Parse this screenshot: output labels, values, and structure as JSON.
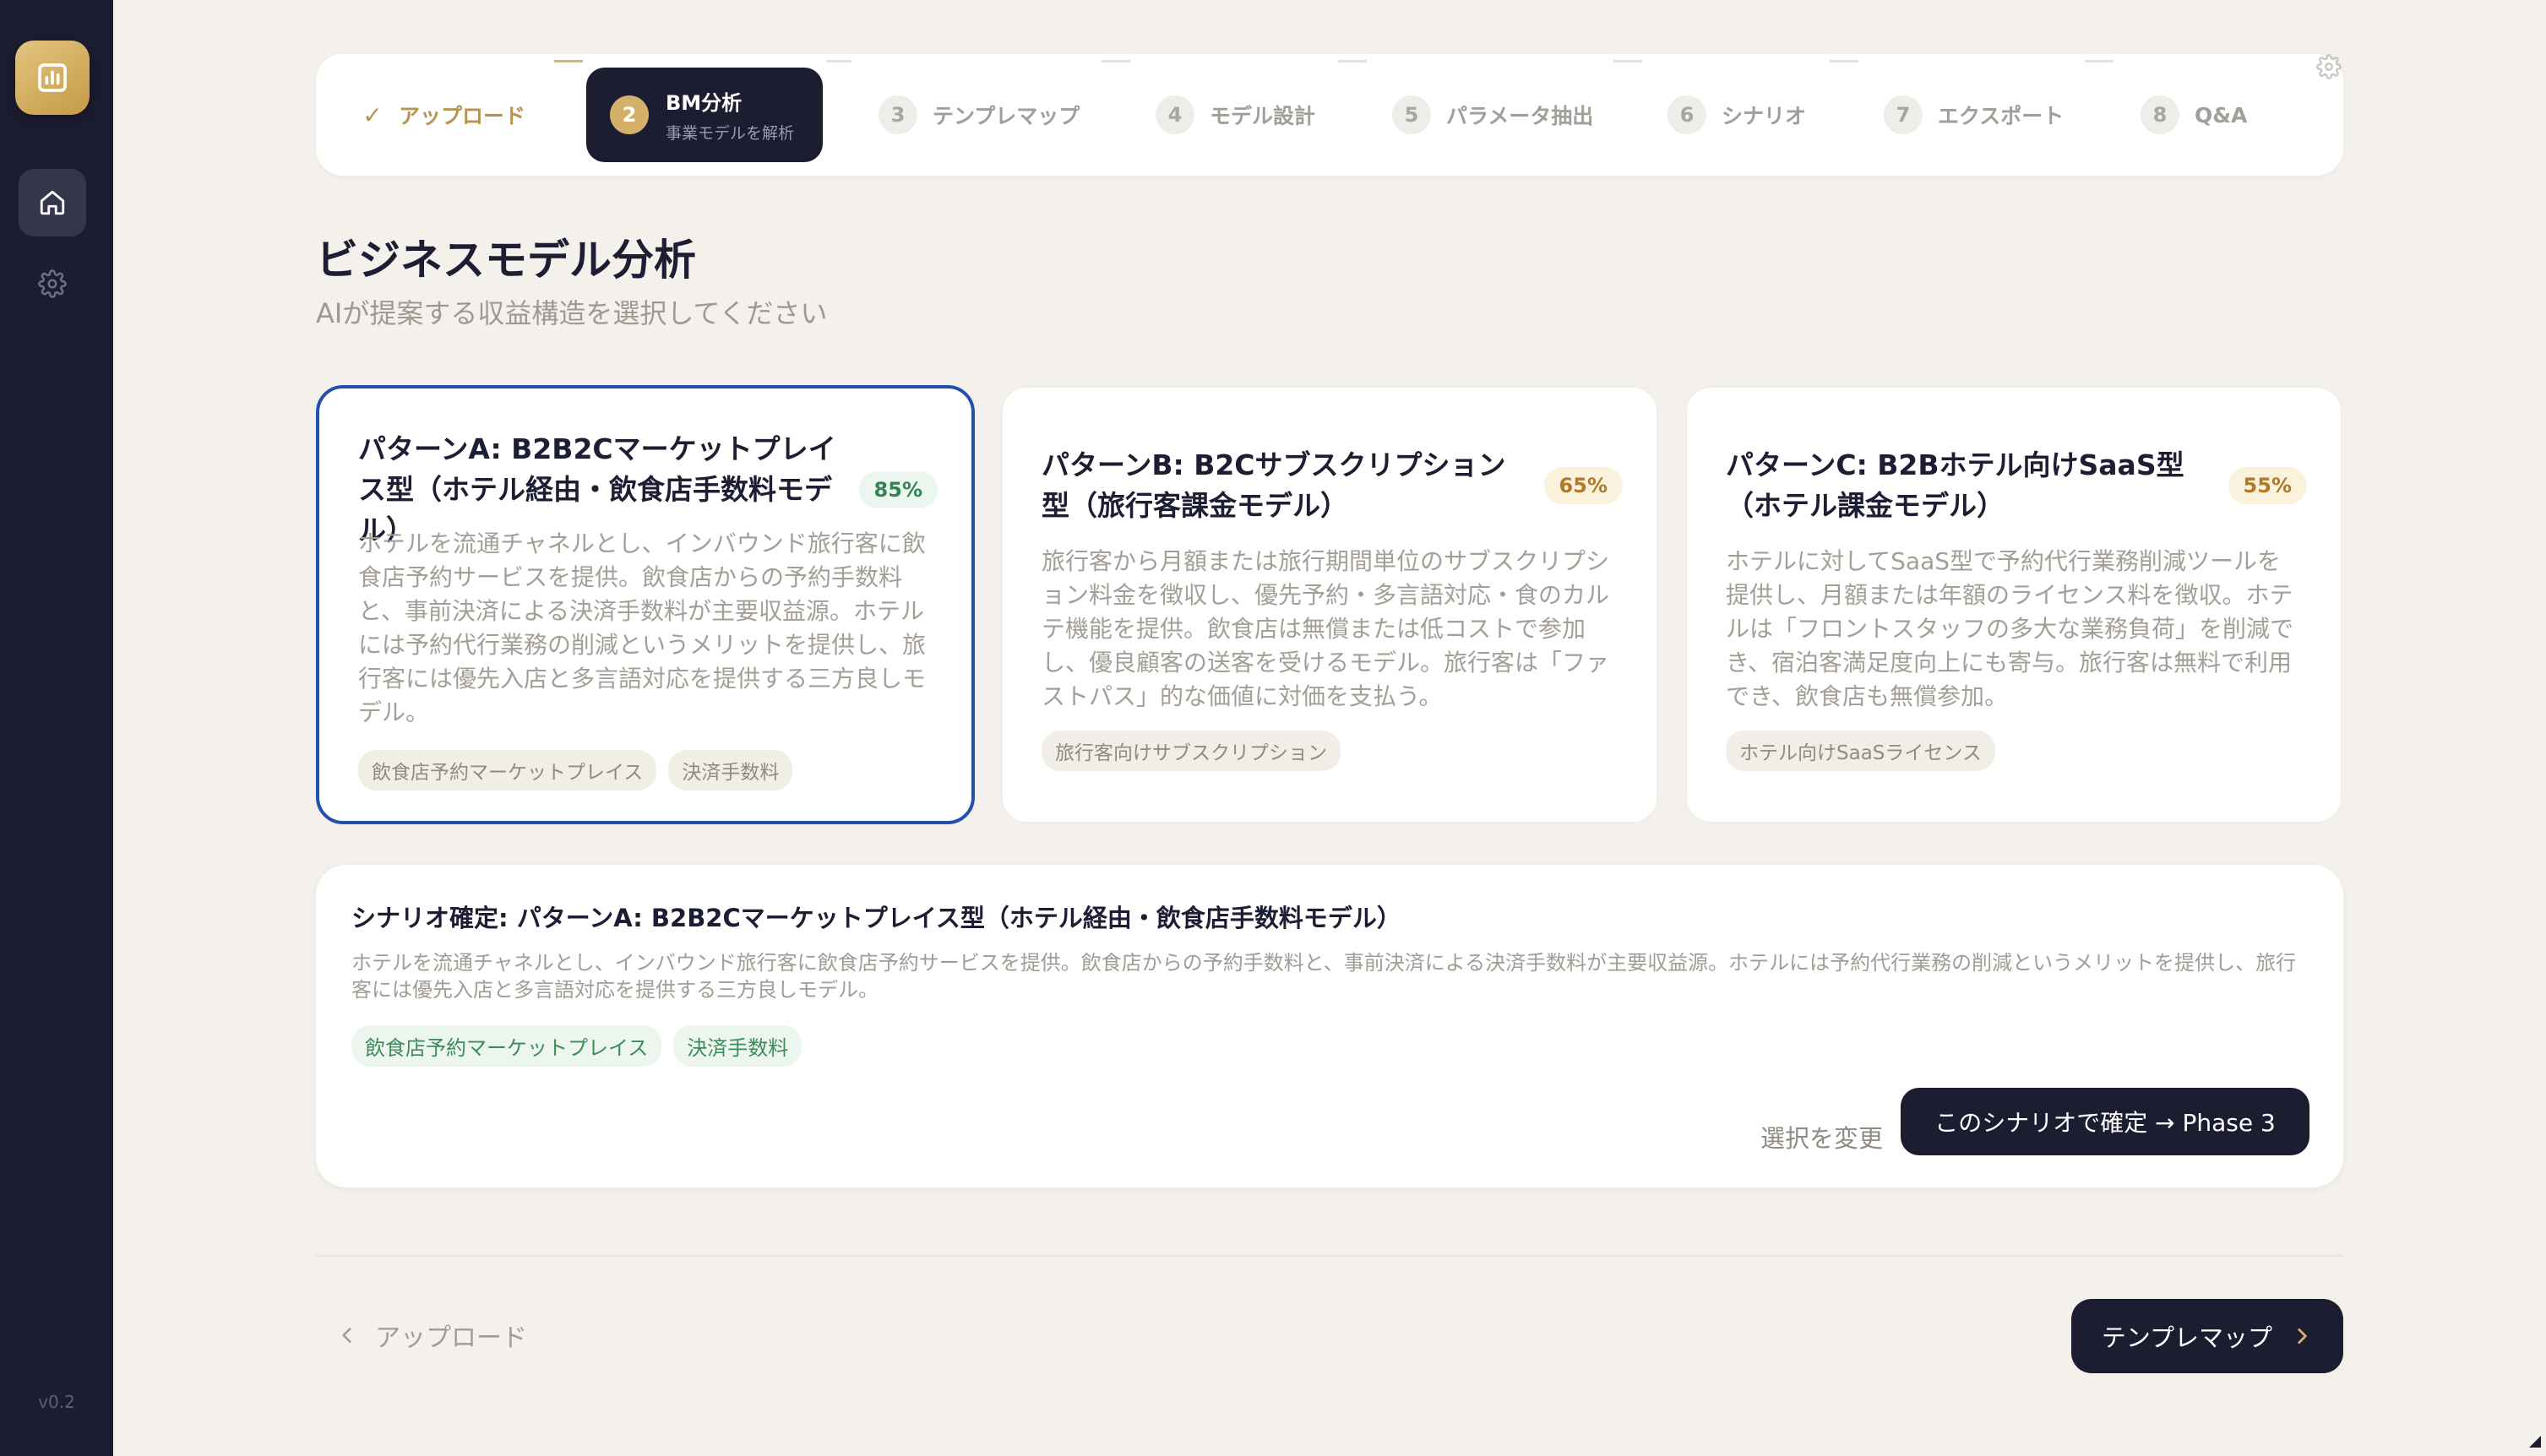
{
  "sidebar": {
    "logo_icon": "bar-chart-icon",
    "nav": [
      {
        "icon": "home-icon",
        "active": true
      },
      {
        "icon": "gear-icon",
        "active": false
      }
    ],
    "version": "v0.2"
  },
  "stepper": {
    "steps": [
      {
        "num": "✓",
        "label": "アップロード",
        "state": "done"
      },
      {
        "num": "2",
        "label": "BM分析",
        "sub": "事業モデルを解析",
        "state": "active"
      },
      {
        "num": "3",
        "label": "テンプレマップ",
        "state": "todo"
      },
      {
        "num": "4",
        "label": "モデル設計",
        "state": "todo"
      },
      {
        "num": "5",
        "label": "パラメータ抽出",
        "state": "todo"
      },
      {
        "num": "6",
        "label": "シナリオ",
        "state": "todo"
      },
      {
        "num": "7",
        "label": "エクスポート",
        "state": "todo"
      },
      {
        "num": "8",
        "label": "Q&A",
        "state": "todo"
      }
    ]
  },
  "page": {
    "title": "ビジネスモデル分析",
    "subtitle": "AIが提案する収益構造を選択してください"
  },
  "cards": [
    {
      "title": "パターンA: B2B2Cマーケットプレイス型（ホテル経由・飲食店手数料モデル）",
      "score": "85%",
      "description": "ホテルを流通チャネルとし、インバウンド旅行客に飲食店予約サービスを提供。飲食店からの予約手数料と、事前決済による決済手数料が主要収益源。ホテルには予約代行業務の削減というメリットを提供し、旅行客には優先入店と多言語対応を提供する三方良しモデル。",
      "tags": [
        "飲食店予約マーケットプレイス",
        "決済手数料"
      ],
      "selected": true
    },
    {
      "title": "パターンB: B2Cサブスクリプション型（旅行客課金モデル）",
      "score": "65%",
      "description": "旅行客から月額または旅行期間単位のサブスクリプション料金を徴収し、優先予約・多言語対応・食のカルテ機能を提供。飲食店は無償または低コストで参加し、優良顧客の送客を受けるモデル。旅行客は「ファストパス」的な価値に対価を支払う。",
      "tags": [
        "旅行客向けサブスクリプション"
      ],
      "selected": false
    },
    {
      "title": "パターンC: B2Bホテル向けSaaS型（ホテル課金モデル）",
      "score": "55%",
      "description": "ホテルに対してSaaS型で予約代行業務削減ツールを提供し、月額または年額のライセンス料を徴収。ホテルは「フロントスタッフの多大な業務負荷」を削減でき、宿泊客満足度向上にも寄与。旅行客は無料で利用でき、飲食店も無償参加。",
      "tags": [
        "ホテル向けSaaSライセンス"
      ],
      "selected": false
    }
  ],
  "confirm": {
    "title": "シナリオ確定: パターンA: B2B2Cマーケットプレイス型（ホテル経由・飲食店手数料モデル）",
    "description": "ホテルを流通チャネルとし、インバウンド旅行客に飲食店予約サービスを提供。飲食店からの予約手数料と、事前決済による決済手数料が主要収益源。ホテルには予約代行業務の削減というメリットを提供し、旅行客には優先入店と多言語対応を提供する三方良しモデル。",
    "tags": [
      "飲食店予約マーケットプレイス",
      "決済手数料"
    ],
    "change_label": "選択を変更",
    "confirm_label": "このシナリオで確定 → Phase 3"
  },
  "footer": {
    "back_label": "アップロード",
    "next_label": "テンプレマップ"
  },
  "colors": {
    "sidebar": "#1d1d31",
    "background": "#f4f1ec",
    "gold": "#c9a45a",
    "selected_border": "#2350ad"
  }
}
